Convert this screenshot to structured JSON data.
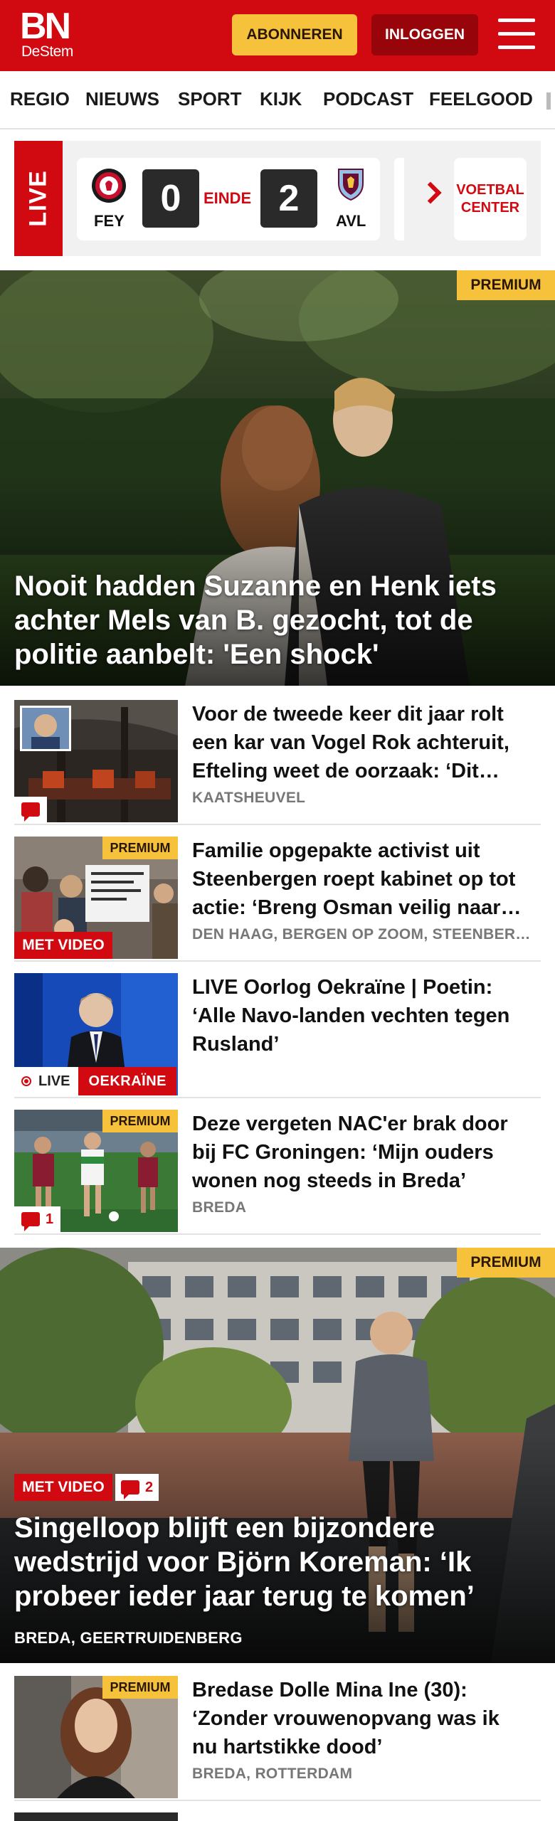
{
  "header": {
    "logo_main": "BN",
    "logo_sub": "DeStem",
    "subscribe_label": "ABONNEREN",
    "login_label": "INLOGGEN",
    "colors": {
      "brand_red": "#d10a11",
      "premium_yellow": "#f6c23b",
      "login_dark_red": "#97040a"
    }
  },
  "nav": {
    "items": [
      "REGIO",
      "NIEUWS",
      "SPORT",
      "KIJK",
      "PODCAST",
      "FEELGOOD"
    ]
  },
  "live_bar": {
    "live_label": "LIVE",
    "home_team": "FEY",
    "away_team": "AVL",
    "home_score": "0",
    "away_score": "2",
    "status": "EINDE",
    "voetbal_center_label": "VOETBAL\nCENTER"
  },
  "hero": {
    "premium_label": "PREMIUM",
    "title": "Nooit hadden Suzanne en Henk iets achter Mels van B. gezocht, tot de politie aanbelt: 'Een shock'"
  },
  "articles": [
    {
      "title": "Voor de tweede keer dit jaar rolt een kar van Vogel Rok achteruit, Efteling weet de oorzaak: ‘Dit wordt verder onderzocht’",
      "meta": "KAATSHEUVEL",
      "comments": ""
    },
    {
      "title": "Familie opgepakte activist uit Steenbergen roept kabinet op tot actie: ‘Breng Osman veilig naar huis’",
      "meta": "DEN HAAG, BERGEN OP ZOOM, STEENBERGEN",
      "premium_label": "PREMIUM",
      "video_label": "MET VIDEO"
    },
    {
      "title": "LIVE Oorlog Oekraïne | Poetin: ‘Alle Navo-landen vechten tegen Rusland’",
      "live_label": "LIVE",
      "topic_label": "OEKRAÏNE"
    },
    {
      "title": "Deze vergeten NAC'er brak door bij FC Groningen: ‘Mijn ouders wonen nog steeds in Breda’",
      "meta": "BREDA",
      "premium_label": "PREMIUM",
      "comments": "1"
    }
  ],
  "hero2": {
    "premium_label": "PREMIUM",
    "video_label": "MET VIDEO",
    "comments": "2",
    "title": "Singelloop blijft een bijzondere wedstrijd voor Björn Koreman: ‘Ik probeer ieder jaar terug te komen’",
    "meta": "BREDA, GEERTRUIDENBERG"
  },
  "article_last": {
    "title": "Bredase Dolle Mina Ine (30): ‘Zonder vrouwenopvang was ik nu hartstikke dood’",
    "meta": "BREDA, ROTTERDAM",
    "premium_label": "PREMIUM"
  }
}
